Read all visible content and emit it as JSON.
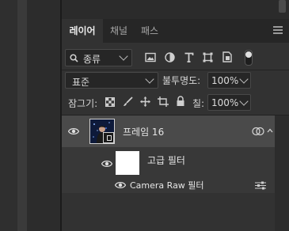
{
  "tabs": [
    {
      "label": "레이어",
      "active": true
    },
    {
      "label": "채널",
      "active": false
    },
    {
      "label": "패스",
      "active": false
    }
  ],
  "filter": {
    "kind_label": "종류",
    "icons": [
      "image-filter-icon",
      "adjustment-filter-icon",
      "type-filter-icon",
      "shape-filter-icon",
      "smart-object-filter-icon",
      "filter-toggle-icon"
    ]
  },
  "blend": {
    "mode": "표준",
    "opacity_label": "불투명도:",
    "opacity_value": "100%"
  },
  "lock": {
    "label": "잠그기:",
    "fill_label": "칠:",
    "fill_value": "100%"
  },
  "layers": [
    {
      "name": "프레임 16",
      "selected": true,
      "visible": true
    },
    {
      "name": "고급 필터",
      "visible": true
    },
    {
      "name": "Camera Raw 필터",
      "visible": true
    }
  ],
  "colors": {
    "panel_bg": "#323232",
    "selected_row": "#4a4a4a",
    "tab_bar": "#262626"
  }
}
